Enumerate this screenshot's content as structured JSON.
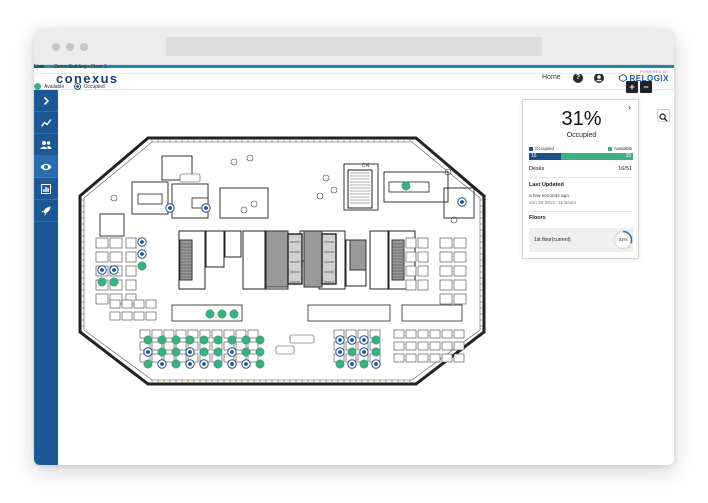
{
  "app": {
    "logo": "conexus",
    "brand_small": "POWERED BY",
    "brand": "RELOGIX"
  },
  "header": {
    "home_label": "Home",
    "help_icon": "question-circle-icon",
    "user_icon": "user-circle-icon"
  },
  "sidebar": {
    "items": [
      {
        "icon": "chevron-right-icon",
        "active": false
      },
      {
        "icon": "trend-chart-icon",
        "active": false
      },
      {
        "icon": "users-icon",
        "active": false
      },
      {
        "icon": "eye-icon",
        "active": true
      },
      {
        "icon": "bar-report-icon",
        "active": false
      },
      {
        "icon": "rocket-icon",
        "active": false
      }
    ]
  },
  "breadcrumb": {
    "live": "Live",
    "separator": "/",
    "path": "Demo Building - Floor 1"
  },
  "legend": {
    "available": {
      "label": "Available",
      "color": "#3daf83"
    },
    "occupied": {
      "label": "Occupied",
      "color": "#1c4f8e"
    }
  },
  "controls": {
    "zoom_in": "+",
    "zoom_out": "−",
    "search_icon": "search-icon"
  },
  "floorplan": {
    "north_label": "CN"
  },
  "panel": {
    "percent": "31%",
    "status": "Occupied",
    "legend_occupied": "Occupied",
    "legend_available": "Available",
    "occupied_count": "16",
    "available_count": "35",
    "occupied_fraction": 0.31,
    "desks_label": "Desks",
    "desks_value": "16/51",
    "last_updated_label": "Last Updated",
    "last_updated_relative": "a few seconds ago",
    "last_updated_time": "Jan 20 2022, 11:52am",
    "floors_label": "Floors",
    "floor_name": "1st floor(current)",
    "floor_percent": "31%",
    "floor_fraction": 0.31
  },
  "colors": {
    "occupied": "#1c4f8e",
    "available": "#3daf83",
    "sidebar": "#1c5896",
    "accent": "#1e88a8"
  }
}
